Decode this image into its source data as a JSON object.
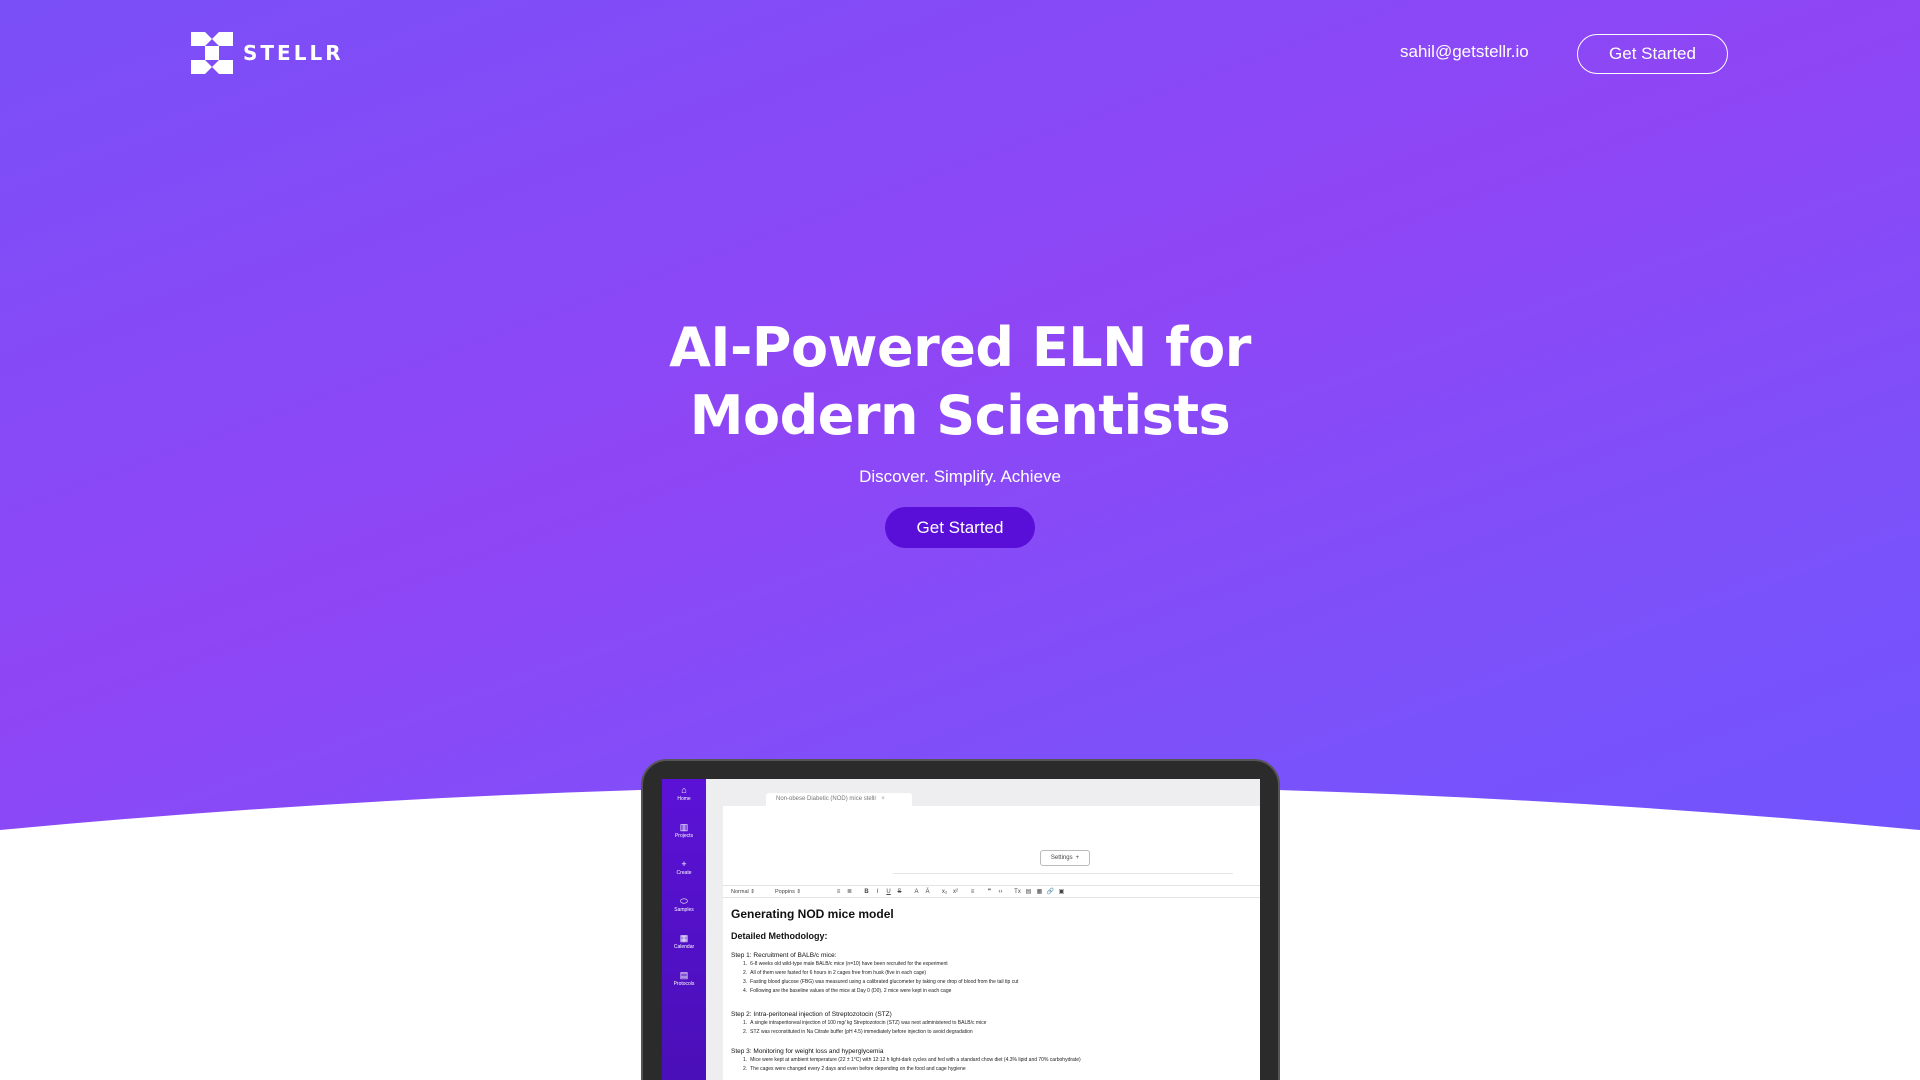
{
  "brand": {
    "name": "STELLR",
    "colors": {
      "hero_gradient_start": "#7a4ff8",
      "hero_gradient_end": "#6a55ff",
      "cta": "#5a0fd8",
      "app_sidebar": "#5b12d6"
    }
  },
  "nav": {
    "email": "sahil@getstellr.io",
    "cta_label": "Get Started"
  },
  "hero": {
    "headline_line1": "AI-Powered ELN for",
    "headline_line2": "Modern Scientists",
    "tagline": "Discover. Simplify. Achieve",
    "cta_label": "Get Started"
  },
  "app": {
    "sidebar": [
      {
        "icon": "home-icon",
        "glyph": "⌂",
        "label": "Home"
      },
      {
        "icon": "projects-icon",
        "glyph": "▥",
        "label": "Projects"
      },
      {
        "icon": "create-icon",
        "glyph": "+",
        "label": "Create"
      },
      {
        "icon": "samples-icon",
        "glyph": "⬭",
        "label": "Samples"
      },
      {
        "icon": "calendar-icon",
        "glyph": "▦",
        "label": "Calendar"
      },
      {
        "icon": "protocols-icon",
        "glyph": "▤",
        "label": "Protocols"
      }
    ],
    "tab_title": "Non-obese Diabetic (NOD) mice stellr",
    "tab_close": "×",
    "settings_label": "Settings",
    "settings_glyph": "+",
    "toolbar": {
      "style_select": "Normal",
      "font_select": "Poppins",
      "buttons": [
        "≡",
        "≣",
        "B",
        "I",
        "U",
        "S",
        "A",
        "Ä",
        "x₂",
        "x²",
        "≡",
        "❞",
        "‹›",
        "Tx",
        "▤",
        "▦",
        "🔗",
        "▣"
      ]
    },
    "document": {
      "title": "Generating NOD mice model",
      "subtitle": "Detailed Methodology:",
      "steps": [
        {
          "title": "Step 1: Recruitment of BALB/c mice:",
          "items": [
            "6-8 weeks old wild-type male BALB/c mice (n=10) have been recruited for the experiment",
            "All of them were fasted for 6 hours in 2 cages free from husk (five in each cage)",
            "Fasting blood glucose (FBG) was measured using a calibrated glucometer by taking one drop of blood from the tail tip cut",
            "Following are the baseline values of the mice at Day 0 (D0). 2 mice were kept in each cage"
          ]
        },
        {
          "title": "Step 2: Intra-peritoneal injection of Streptozotocin (STZ)",
          "items": [
            "A single intraperitoneal injection of 100 mg/ kg Streptozotocin (STZ) was next administered to BALB/c mice",
            "STZ was reconstituted in Na Citrate buffer (pH 4.5) immediately before injection to avoid degradation"
          ]
        },
        {
          "title": "Step 3: Monitoring for weight loss and hyperglycemia",
          "items": [
            "Mice were kept at ambient temperature (22 ± 1°C) with 12:12 h light-dark cycles and fed with a standard chow diet (4.3% lipid and 70% carbohydrate)",
            "The cages were changed every 2 days and even before depending on the food and cage hygiene"
          ]
        }
      ]
    }
  }
}
